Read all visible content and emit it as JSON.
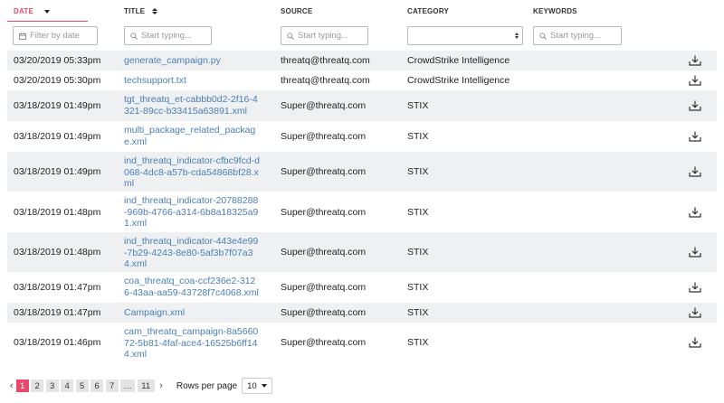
{
  "columns": {
    "date": "DATE",
    "title": "TITLE",
    "source": "SOURCE",
    "category": "CATEGORY",
    "keywords": "KEYWORDS"
  },
  "filters": {
    "date_placeholder": "Filter by date",
    "title_placeholder": "Start typing...",
    "source_placeholder": "Start typing...",
    "category_value": "",
    "keywords_placeholder": "Start typing..."
  },
  "rows": [
    {
      "date": "03/20/2019 05:33pm",
      "title": "generate_campaign.py",
      "source": "threatq@threatq.com",
      "category": "CrowdStrike Intelligence"
    },
    {
      "date": "03/20/2019 05:30pm",
      "title": "techsupport.txt",
      "source": "threatq@threatq.com",
      "category": "CrowdStrike Intelligence"
    },
    {
      "date": "03/18/2019 01:49pm",
      "title": "tgt_threatq_et-cabbb0d2-2f16-4321-89cc-b33415a63891.xml",
      "source": "Super@threatq.com",
      "category": "STIX"
    },
    {
      "date": "03/18/2019 01:49pm",
      "title": "multi_package_related_package.xml",
      "source": "Super@threatq.com",
      "category": "STIX"
    },
    {
      "date": "03/18/2019 01:49pm",
      "title": "ind_threatq_indicator-cfbc9fcd-d068-4dc8-a57b-cda54868bf28.xml",
      "source": "Super@threatq.com",
      "category": "STIX"
    },
    {
      "date": "03/18/2019 01:48pm",
      "title": "ind_threatq_indicator-20788288-969b-4766-a314-6b8a18325a91.xml",
      "source": "Super@threatq.com",
      "category": "STIX"
    },
    {
      "date": "03/18/2019 01:48pm",
      "title": "ind_threatq_indicator-443e4e99-7b29-4243-8e80-5af3b7f07a34.xml",
      "source": "Super@threatq.com",
      "category": "STIX"
    },
    {
      "date": "03/18/2019 01:47pm",
      "title": "coa_threatq_coa-ccf236e2-3126-43aa-aa59-43728f7c4068.xml",
      "source": "Super@threatq.com",
      "category": "STIX"
    },
    {
      "date": "03/18/2019 01:47pm",
      "title": "Campaign.xml",
      "source": "Super@threatq.com",
      "category": "STIX"
    },
    {
      "date": "03/18/2019 01:46pm",
      "title": "cam_threatq_campaign-8a566072-5b81-4faf-ace4-16525b6ff144.xml",
      "source": "Super@threatq.com",
      "category": "STIX"
    }
  ],
  "pagination": {
    "prev": "‹",
    "next": "›",
    "pages": [
      "1",
      "2",
      "3",
      "4",
      "5",
      "6",
      "7",
      "…",
      "11"
    ],
    "current": "1",
    "rows_per_page_label": "Rows per page",
    "rows_per_page_value": "10"
  },
  "colors": {
    "accent": "#e8496b",
    "link": "#4a7fb5",
    "stripe": "#eef0f2"
  },
  "icons": {
    "calendar": "calendar-icon",
    "search": "search-icon",
    "download": "download-icon"
  }
}
